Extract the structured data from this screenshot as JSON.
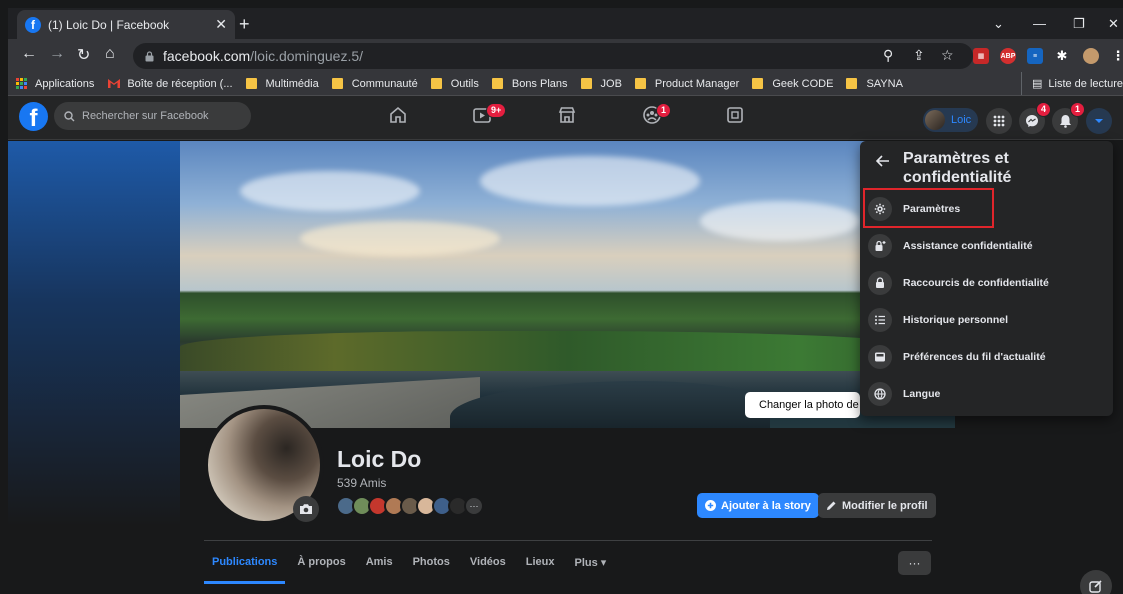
{
  "browser": {
    "tab_title": "(1) Loic Do | Facebook",
    "tab_favicon": "f",
    "url_host": "facebook.com",
    "url_path": "/loic.dominguez.5/",
    "extensions": [
      "ABP"
    ],
    "bookmarks": [
      {
        "label": "Applications",
        "type": "apps"
      },
      {
        "label": "Boîte de réception (...",
        "type": "gmail"
      },
      {
        "label": "Multimédia",
        "type": "folder"
      },
      {
        "label": "Communauté",
        "type": "folder"
      },
      {
        "label": "Outils",
        "type": "folder"
      },
      {
        "label": "Bons Plans",
        "type": "folder"
      },
      {
        "label": "JOB",
        "type": "folder"
      },
      {
        "label": "Product Manager",
        "type": "folder"
      },
      {
        "label": "Geek CODE",
        "type": "folder"
      },
      {
        "label": "SAYNA",
        "type": "folder"
      }
    ],
    "reading_list": "Liste de lecture"
  },
  "fb_header": {
    "logo": "f",
    "search_placeholder": "Rechercher sur Facebook",
    "watch_badge": "9+",
    "groups_badge": "1",
    "profile_name": "Loic",
    "messenger_badge": "4",
    "notifications_badge": "1"
  },
  "profile": {
    "name": "Loic Do",
    "friends_count": "539 Amis",
    "change_cover_label": "Changer la photo de couverture",
    "add_story_label": "Ajouter à la story",
    "edit_profile_label": "Modifier le profil",
    "more_label": "···",
    "tabs": [
      "Publications",
      "À propos",
      "Amis",
      "Photos",
      "Vidéos",
      "Lieux",
      "Plus ▾"
    ]
  },
  "menu": {
    "title": "Paramètres et confidentialité",
    "items": [
      {
        "label": "Paramètres",
        "icon": "gear-icon"
      },
      {
        "label": "Assistance confidentialité",
        "icon": "lock-plus-icon"
      },
      {
        "label": "Raccourcis de confidentialité",
        "icon": "lock-icon"
      },
      {
        "label": "Historique personnel",
        "icon": "list-icon"
      },
      {
        "label": "Préférences du fil d'actualité",
        "icon": "feed-icon"
      },
      {
        "label": "Langue",
        "icon": "globe-icon"
      }
    ]
  },
  "colors": {
    "fb_blue": "#2d88ff",
    "highlight": "#e0252b",
    "badge_red": "#e41e3f"
  }
}
